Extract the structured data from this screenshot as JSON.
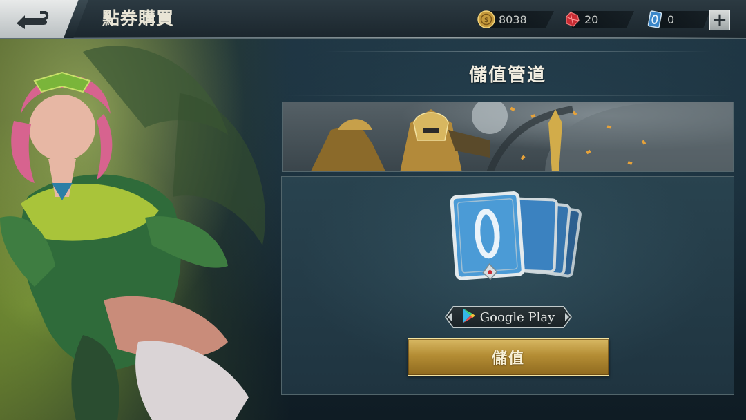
{
  "header": {
    "title": "點券購買"
  },
  "currencies": [
    {
      "icon": "gold-coin-icon",
      "value": "8038"
    },
    {
      "icon": "red-gem-icon",
      "value": "20"
    },
    {
      "icon": "blue-voucher-icon",
      "value": "0"
    }
  ],
  "main": {
    "section_title": "儲值管道",
    "payment_channel": "Google Play",
    "topup_button": "儲值"
  },
  "colors": {
    "accent_gold": "#c9a24a",
    "panel_bg": "#243c48",
    "text_light": "#f1ede0"
  }
}
